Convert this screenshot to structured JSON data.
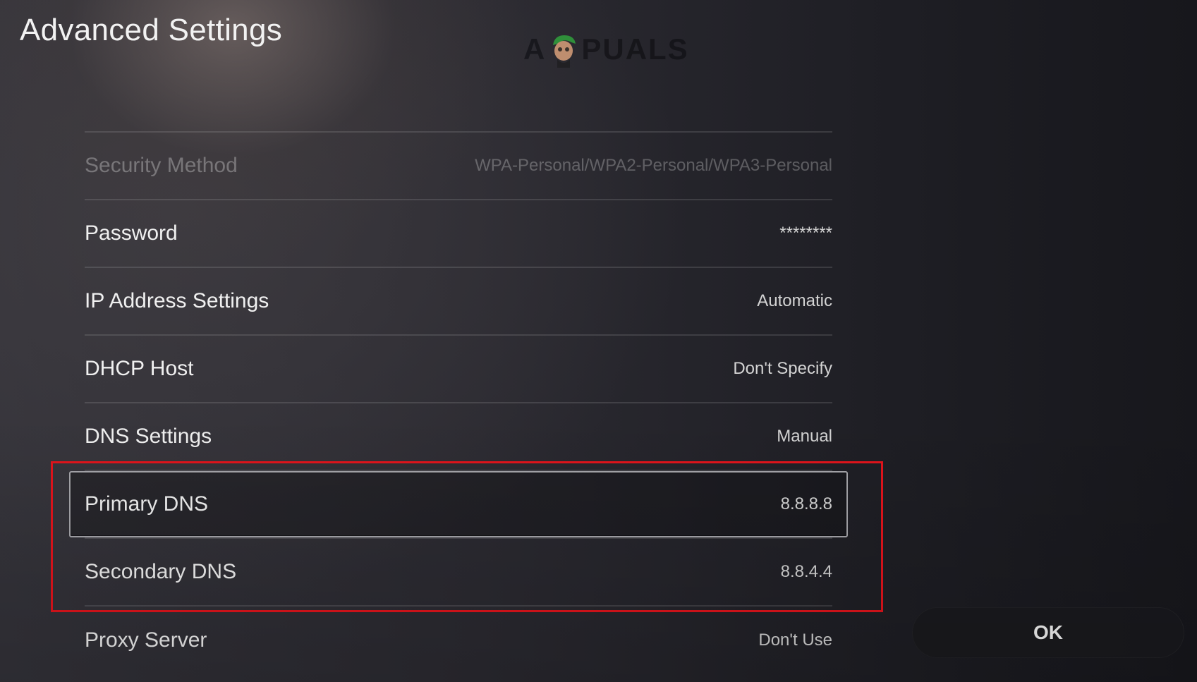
{
  "header": {
    "title": "Advanced Settings",
    "watermark": {
      "prefix": "A",
      "suffix": "PUALS"
    }
  },
  "settings": [
    {
      "label": "Security Method",
      "value": "WPA-Personal/WPA2-Personal/WPA3-Personal",
      "disabled": true
    },
    {
      "label": "Password",
      "value": "********"
    },
    {
      "label": "IP Address Settings",
      "value": "Automatic"
    },
    {
      "label": "DHCP Host",
      "value": "Don't Specify"
    },
    {
      "label": "DNS Settings",
      "value": "Manual"
    },
    {
      "label": "Primary DNS",
      "value": "8.8.8.8",
      "focused": true
    },
    {
      "label": "Secondary DNS",
      "value": "8.8.4.4"
    },
    {
      "label": "Proxy Server",
      "value": "Don't Use"
    }
  ],
  "buttons": {
    "ok_label": "OK"
  },
  "colors": {
    "highlight": "#e3141c",
    "focus_border": "#a6a6ab"
  }
}
